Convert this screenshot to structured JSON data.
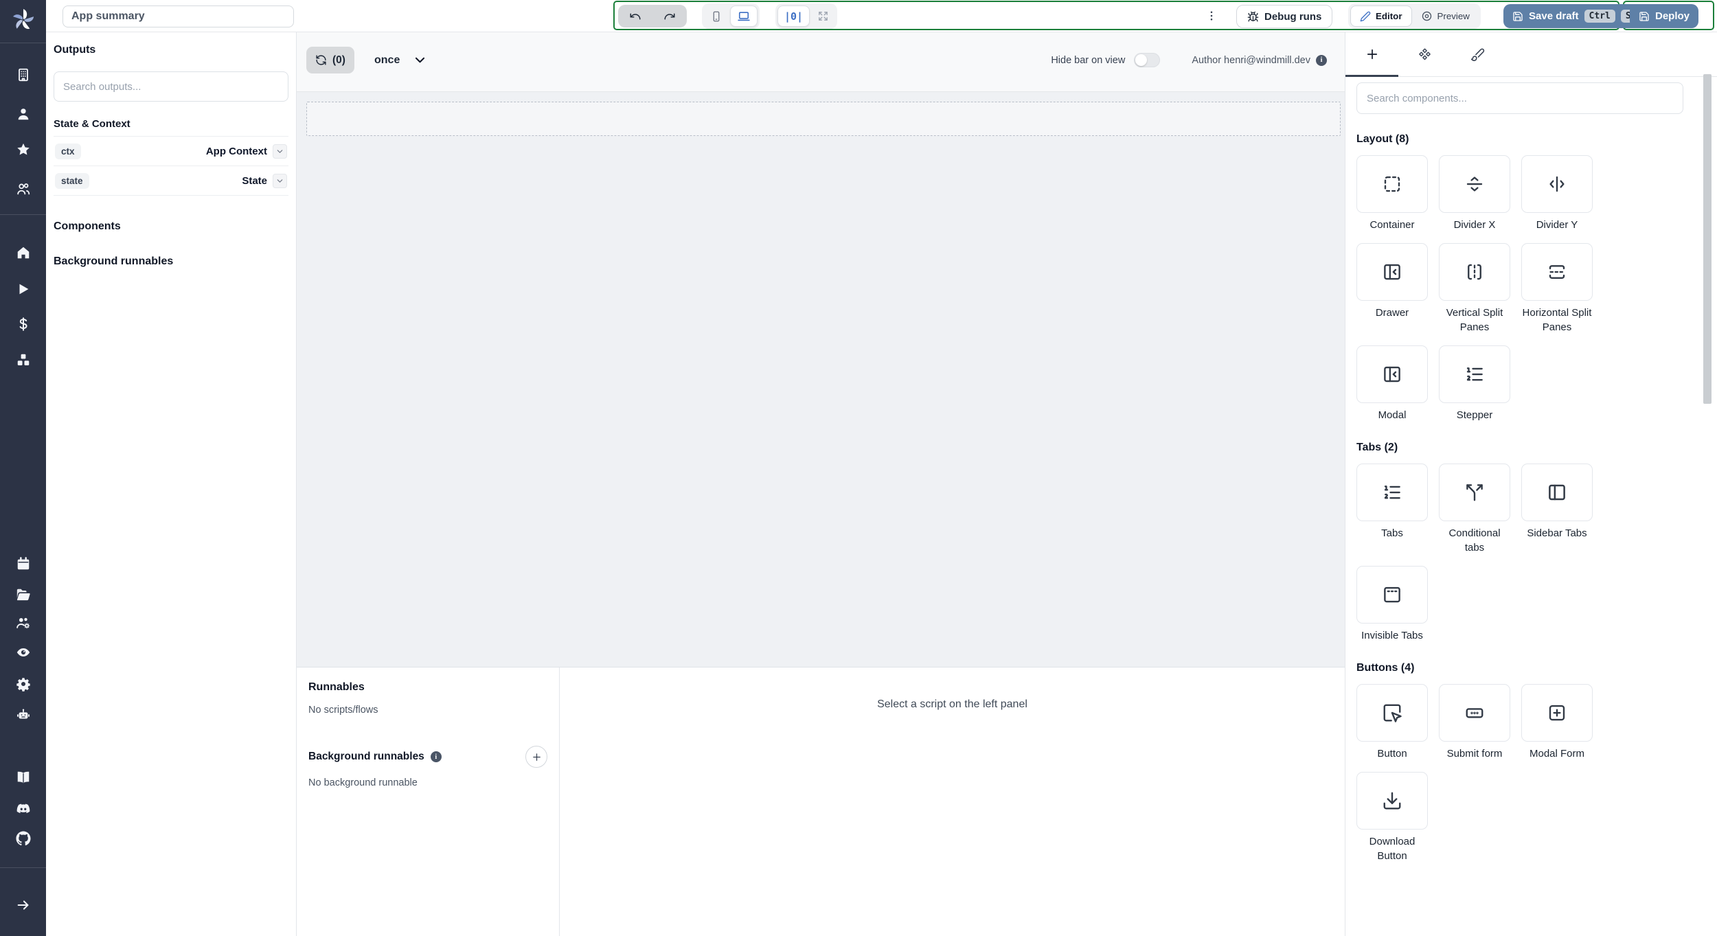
{
  "topbar": {
    "app_summary_placeholder": "App summary",
    "debug_runs_label": "Debug runs",
    "editor_label": "Editor",
    "preview_label": "Preview",
    "save_draft_label": "Save draft",
    "ctrl_key": "Ctrl",
    "s_key": "S",
    "deploy_label": "Deploy",
    "align_label": "|0|"
  },
  "sidebar": {
    "icons": [
      {
        "name": "windmill-logo-icon"
      },
      {
        "name": "building-icon"
      },
      {
        "name": "user-icon"
      },
      {
        "name": "star-icon"
      },
      {
        "name": "users-icon"
      },
      {
        "name": "home-icon"
      },
      {
        "name": "play-icon"
      },
      {
        "name": "dollar-icon"
      },
      {
        "name": "boxes-icon"
      },
      {
        "name": "calendar-icon"
      },
      {
        "name": "folder-open-icon"
      },
      {
        "name": "users-cog-icon"
      },
      {
        "name": "eye-icon"
      },
      {
        "name": "gear-icon"
      },
      {
        "name": "robot-icon"
      },
      {
        "name": "book-icon"
      },
      {
        "name": "discord-icon"
      },
      {
        "name": "github-icon"
      },
      {
        "name": "arrow-right-icon"
      }
    ]
  },
  "left_panel": {
    "outputs_title": "Outputs",
    "search_placeholder": "Search outputs...",
    "state_context_title": "State & Context",
    "rows": [
      {
        "key": "ctx",
        "value": "App Context"
      },
      {
        "key": "state",
        "value": "State"
      }
    ],
    "components_title": "Components",
    "background_title": "Background runnables"
  },
  "canvas": {
    "refresh_count": "(0)",
    "mode_label": "once",
    "hide_bar_label": "Hide bar on view",
    "author_label": "Author henri@windmill.dev"
  },
  "runnables": {
    "title": "Runnables",
    "empty_scripts": "No scripts/flows",
    "background_title": "Background runnables",
    "empty_background": "No background runnable",
    "select_hint": "Select a script on the left panel"
  },
  "components_panel": {
    "search_placeholder": "Search components...",
    "sections": [
      {
        "title": "Layout (8)",
        "items": [
          {
            "label": "Container",
            "icon": "container-icon"
          },
          {
            "label": "Divider X",
            "icon": "divider-x-icon"
          },
          {
            "label": "Divider Y",
            "icon": "divider-y-icon"
          },
          {
            "label": "Drawer",
            "icon": "drawer-icon"
          },
          {
            "label": "Vertical Split Panes",
            "icon": "vertical-split-icon"
          },
          {
            "label": "Horizontal Split Panes",
            "icon": "horizontal-split-icon"
          },
          {
            "label": "Modal",
            "icon": "drawer-icon"
          },
          {
            "label": "Stepper",
            "icon": "list-ordered-icon"
          }
        ]
      },
      {
        "title": "Tabs (2)",
        "items": [
          {
            "label": "Tabs",
            "icon": "list-ordered-icon"
          },
          {
            "label": "Conditional tabs",
            "icon": "split-icon"
          },
          {
            "label": "Sidebar Tabs",
            "icon": "panel-left-icon"
          },
          {
            "label": "Invisible Tabs",
            "icon": "invisible-tabs-icon"
          },
          {
            "label": "",
            "icon": ""
          }
        ]
      },
      {
        "title": "Buttons (4)",
        "items": [
          {
            "label": "Button",
            "icon": "button-click-icon"
          },
          {
            "label": "Submit form",
            "icon": "submit-form-icon"
          },
          {
            "label": "Modal Form",
            "icon": "square-plus-icon"
          },
          {
            "label": "Download Button",
            "icon": "download-icon"
          }
        ]
      }
    ]
  },
  "colors": {
    "primary_blue": "#5e80a7",
    "annotation_green": "#1b7f3a",
    "sidebar_dark": "#2c3345",
    "active_icon_blue": "#3c6fc4"
  }
}
